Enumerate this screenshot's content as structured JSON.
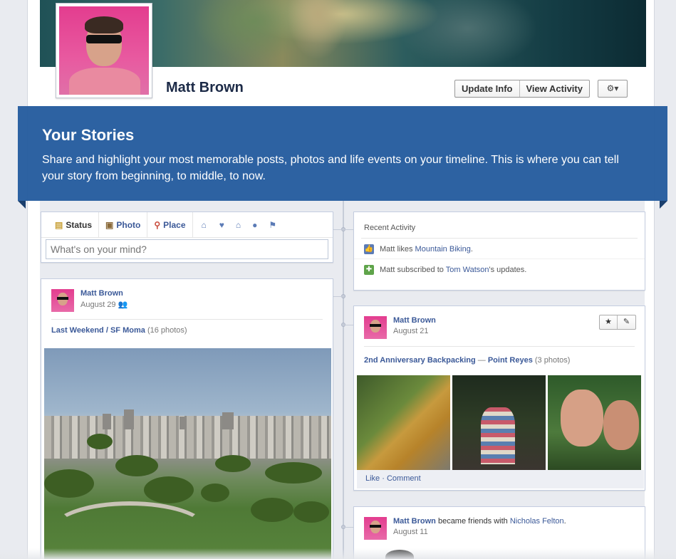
{
  "profile": {
    "name": "Matt Brown",
    "buttons": {
      "update_info": "Update Info",
      "view_activity": "View Activity",
      "gear": "⚙▾"
    }
  },
  "banner": {
    "title": "Your Stories",
    "text": "Share and highlight your most memorable posts, photos and life events on your timeline. This is where you can tell your story from beginning, to middle, to now."
  },
  "composer": {
    "tabs": [
      {
        "label": "Status",
        "icon": "status-icon"
      },
      {
        "label": "Photo",
        "icon": "photo-icon"
      },
      {
        "label": "Place",
        "icon": "place-icon"
      }
    ],
    "life_event_icons": [
      "work-icon",
      "heart-icon",
      "home-icon",
      "health-icon",
      "flag-icon"
    ],
    "placeholder": "What's on your mind?"
  },
  "recent_activity": {
    "title": "Recent Activity",
    "items": [
      {
        "actor": "Matt",
        "verb": "likes",
        "object": "Mountain Biking",
        "suffix": "."
      },
      {
        "actor": "Matt",
        "verb": "subscribed to",
        "object": "Tom Watson",
        "suffix": "'s updates."
      }
    ]
  },
  "post_left": {
    "author": "Matt Brown",
    "date": "August 29",
    "album": "Last Weekend",
    "separator": "/",
    "place": "SF Moma",
    "count": "(16 photos)"
  },
  "post_right": {
    "author": "Matt Brown",
    "date": "August 21",
    "album": "2nd Anniversary Backpacking",
    "separator": "—",
    "place": "Point Reyes",
    "count": "(3 photos)",
    "actions": {
      "like": "Like",
      "dot": "·",
      "comment": "Comment"
    },
    "edit_buttons": [
      "★",
      "✎"
    ]
  },
  "post_friend": {
    "author": "Matt Brown",
    "verb": "became friends with",
    "friend": "Nicholas Felton",
    "suffix": ".",
    "date": "August 11"
  },
  "colors": {
    "banner": "#2e67a8",
    "link": "#3b5998"
  }
}
